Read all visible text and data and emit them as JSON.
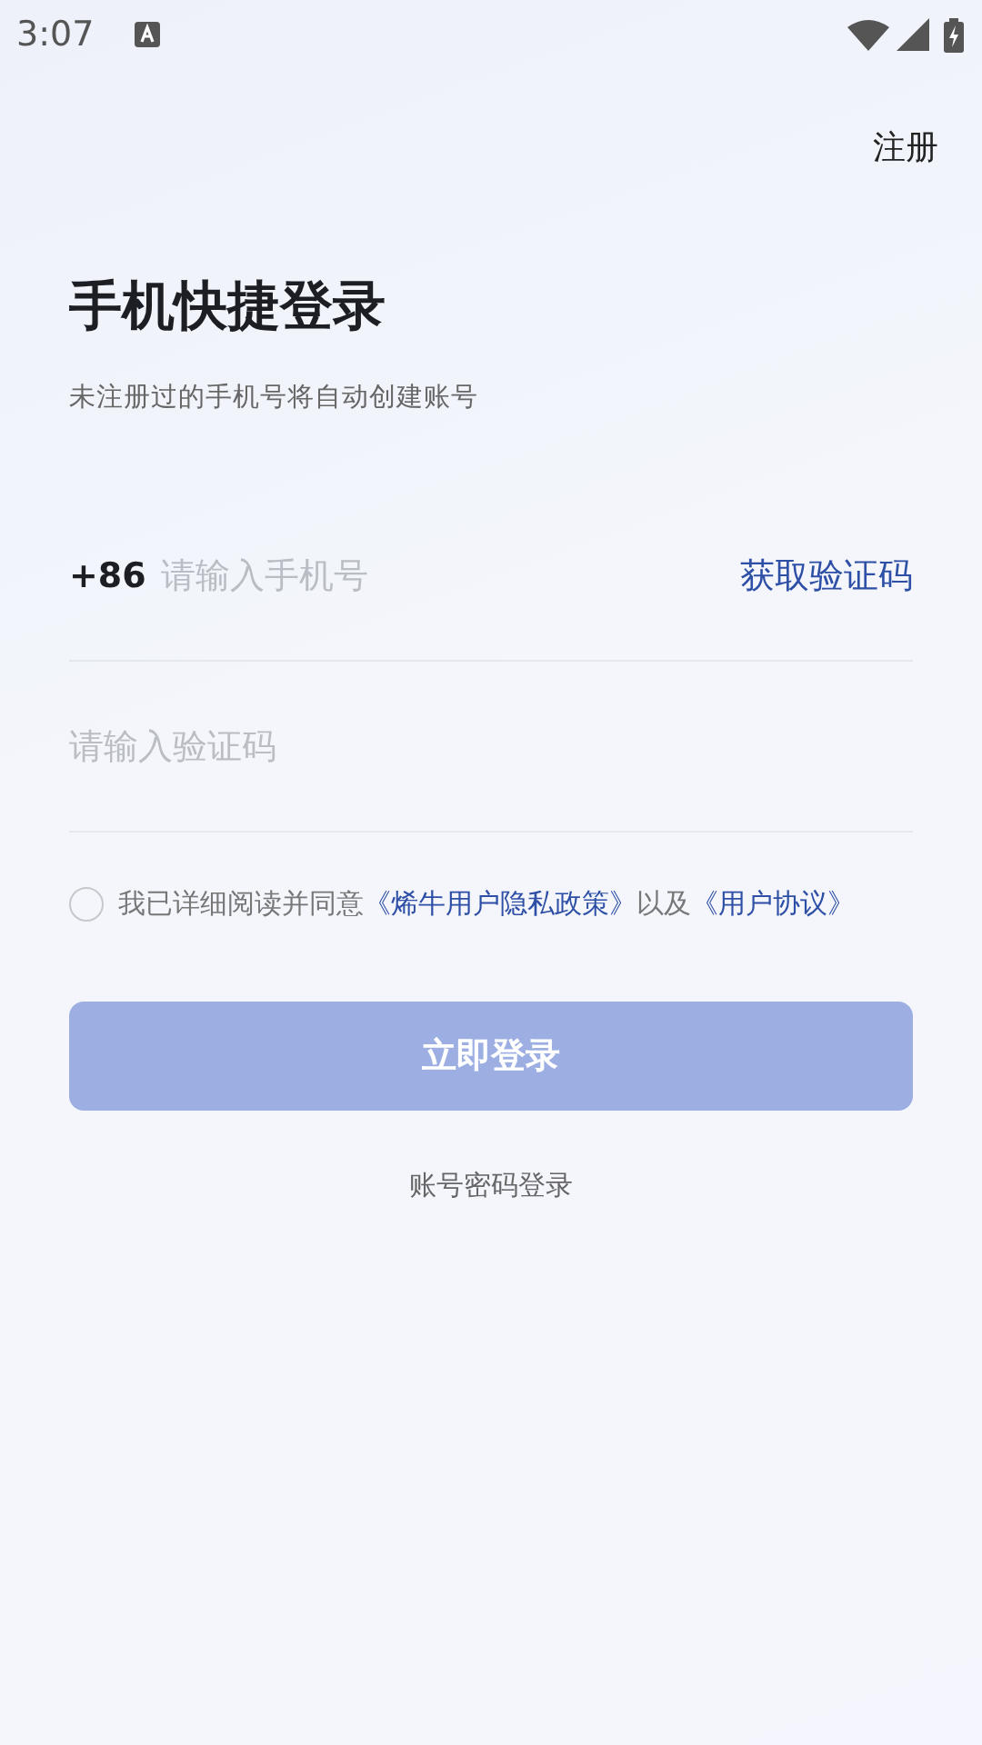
{
  "status_bar": {
    "time": "3:07"
  },
  "register_link": "注册",
  "title": "手机快捷登录",
  "subtitle": "未注册过的手机号将自动创建账号",
  "phone_field": {
    "prefix": "+86",
    "placeholder": "请输入手机号",
    "action": "获取验证码"
  },
  "code_field": {
    "placeholder": "请输入验证码"
  },
  "agreement": {
    "checked": false,
    "parts": [
      {
        "kind": "text",
        "text": "我已详细阅读并同意"
      },
      {
        "kind": "link",
        "text": "《烯牛用户隐私政策》"
      },
      {
        "kind": "text",
        "text": "以及"
      },
      {
        "kind": "link",
        "text": "《用户协议》"
      }
    ]
  },
  "login_button": {
    "label": "立即登录",
    "disabled": true
  },
  "alt_login_link": "账号密码登录"
}
